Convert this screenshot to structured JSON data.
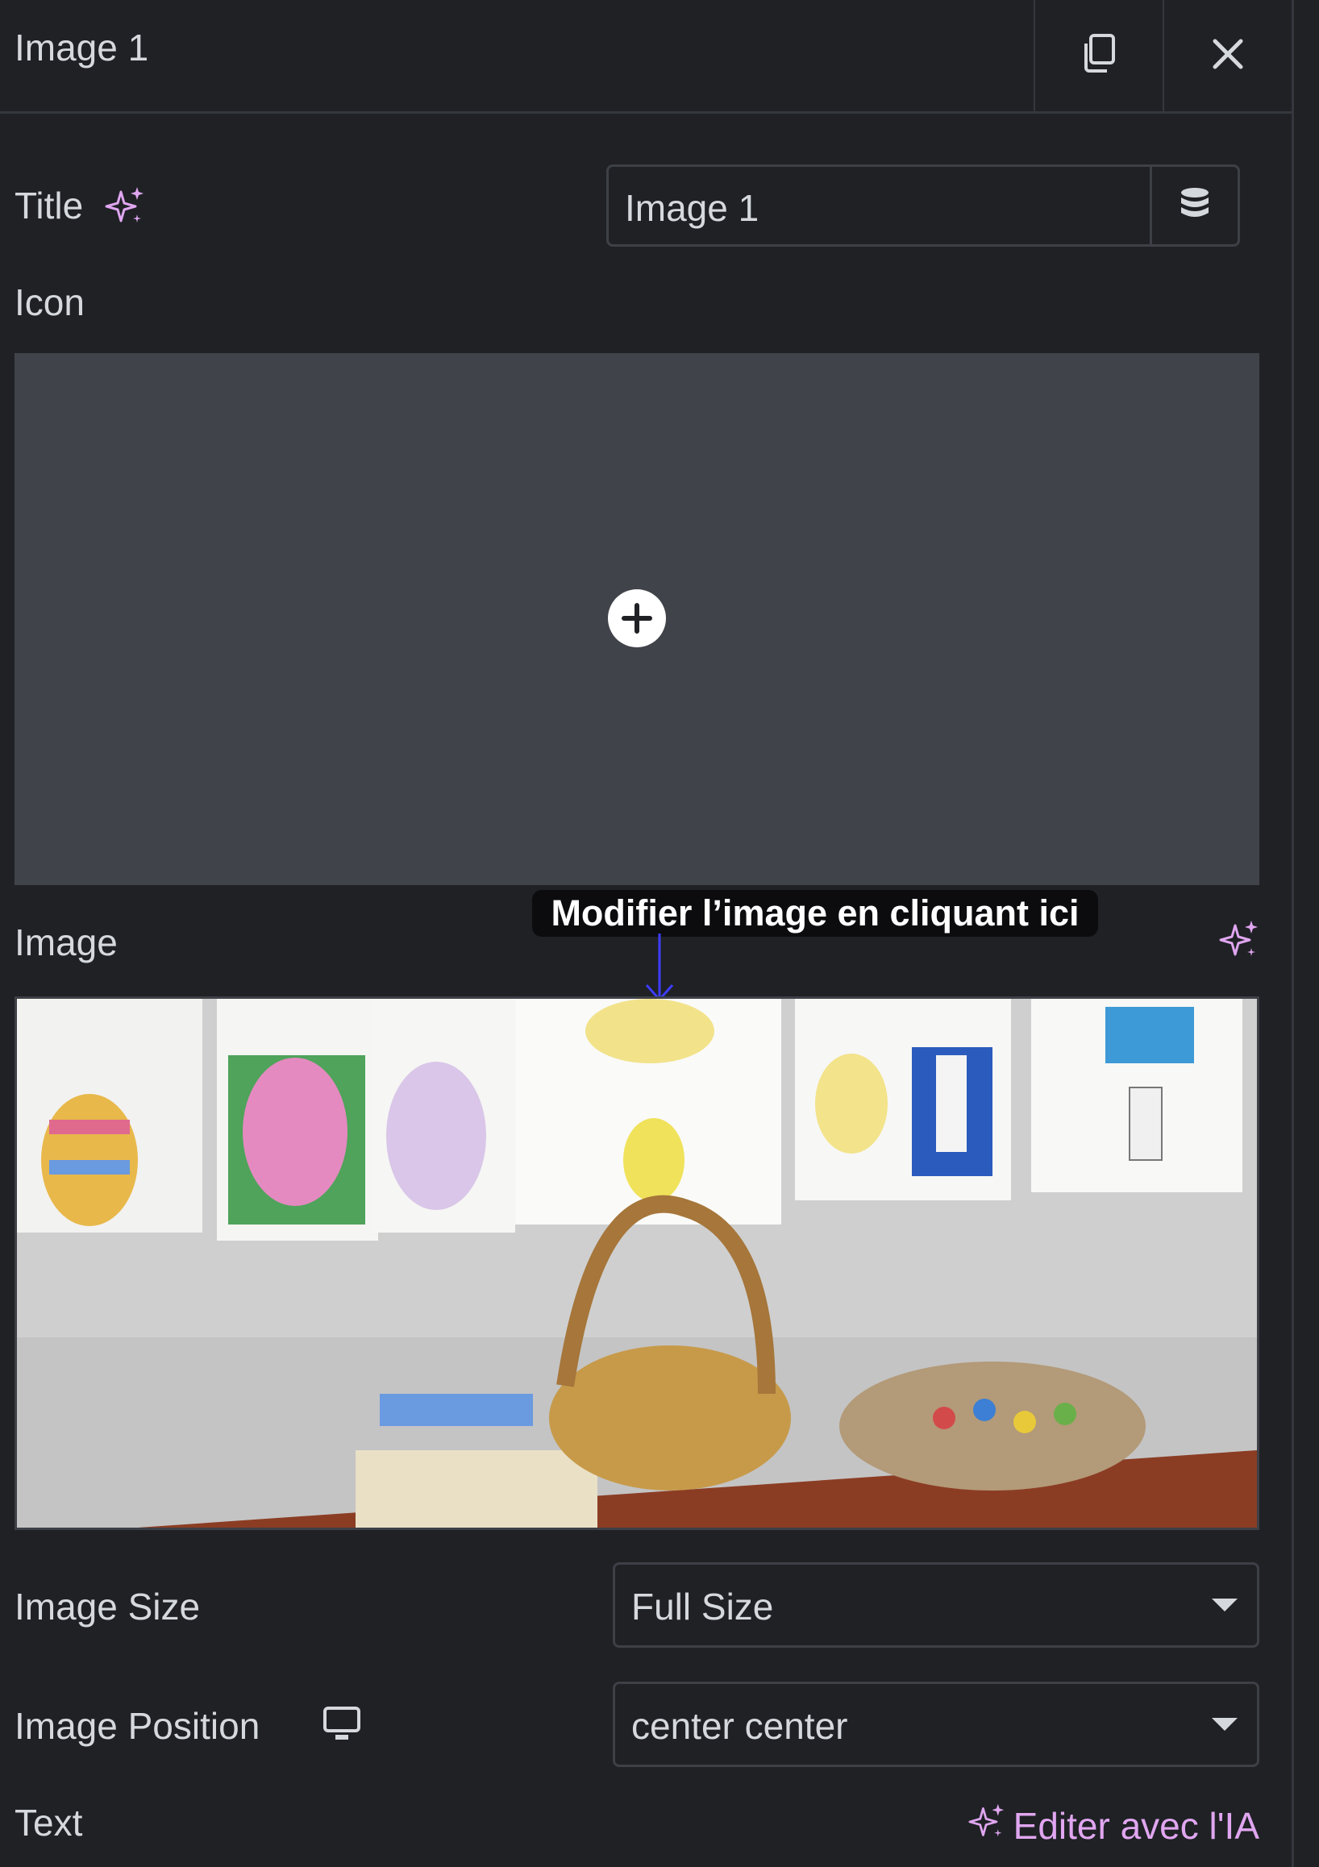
{
  "header": {
    "title": "Image 1"
  },
  "fields": {
    "title_label": "Title",
    "title_value": "Image 1",
    "icon_label": "Icon",
    "image_label": "Image",
    "image_size_label": "Image Size",
    "image_size_value": "Full Size",
    "image_position_label": "Image Position",
    "image_position_value": "center center",
    "text_label": "Text"
  },
  "tooltip": {
    "text": "Modifier l’image en cliquant ici"
  },
  "ai": {
    "edit_label": "Editer avec l'IA"
  },
  "colors": {
    "background": "#1f2125",
    "panel": "#404349",
    "accent": "#e0a6f0",
    "arrow": "#3d3dff"
  },
  "icons": {
    "header_copy": "copy-icon",
    "header_close": "close-icon",
    "title_ai": "sparkle-icon",
    "dynamic": "database-icon",
    "add": "plus-circle-icon",
    "image_ai": "sparkle-icon",
    "responsive": "desktop-icon",
    "text_ai": "sparkle-icon"
  }
}
